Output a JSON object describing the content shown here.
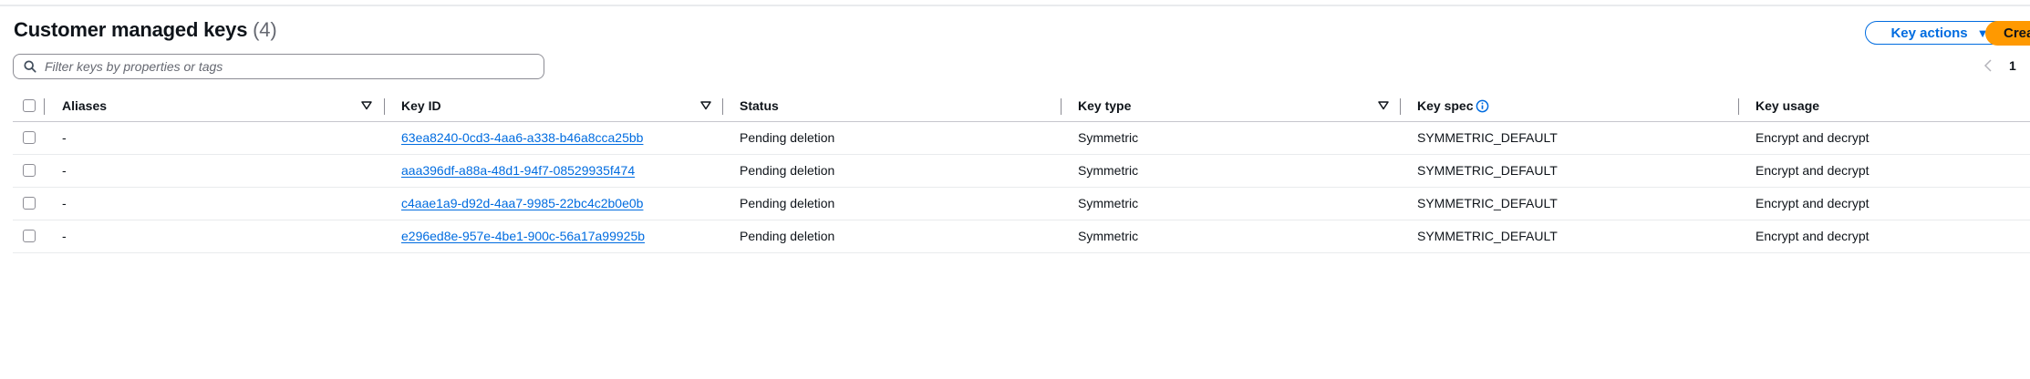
{
  "header": {
    "title": "Customer managed keys",
    "count": "(4)"
  },
  "toolbar": {
    "key_actions_label": "Key actions",
    "create_label": "Create key"
  },
  "filter": {
    "placeholder": "Filter keys by properties or tags",
    "value": ""
  },
  "pagination": {
    "current_page": "1"
  },
  "table": {
    "columns": [
      "Aliases",
      "Key ID",
      "Status",
      "Key type",
      "Key spec",
      "Key usage"
    ],
    "rows": [
      {
        "alias": "-",
        "key_id": "63ea8240-0cd3-4aa6-a338-b46a8cca25bb",
        "status": "Pending deletion",
        "key_type": "Symmetric",
        "key_spec": "SYMMETRIC_DEFAULT",
        "key_usage": "Encrypt and decrypt"
      },
      {
        "alias": "-",
        "key_id": "aaa396df-a88a-48d1-94f7-08529935f474",
        "status": "Pending deletion",
        "key_type": "Symmetric",
        "key_spec": "SYMMETRIC_DEFAULT",
        "key_usage": "Encrypt and decrypt"
      },
      {
        "alias": "-",
        "key_id": "c4aae1a9-d92d-4aa7-9985-22bc4c2b0e0b",
        "status": "Pending deletion",
        "key_type": "Symmetric",
        "key_spec": "SYMMETRIC_DEFAULT",
        "key_usage": "Encrypt and decrypt"
      },
      {
        "alias": "-",
        "key_id": "e296ed8e-957e-4be1-900c-56a17a99925b",
        "status": "Pending deletion",
        "key_type": "Symmetric",
        "key_spec": "SYMMETRIC_DEFAULT",
        "key_usage": "Encrypt and decrypt"
      }
    ]
  },
  "colors": {
    "link": "#006ce0",
    "primary_button": "#ff9900",
    "text": "#0f141a",
    "muted": "#656871"
  },
  "icons": [
    "search-icon",
    "sort-caret-icon",
    "info-icon",
    "chevron-left-icon",
    "caret-down-icon"
  ]
}
